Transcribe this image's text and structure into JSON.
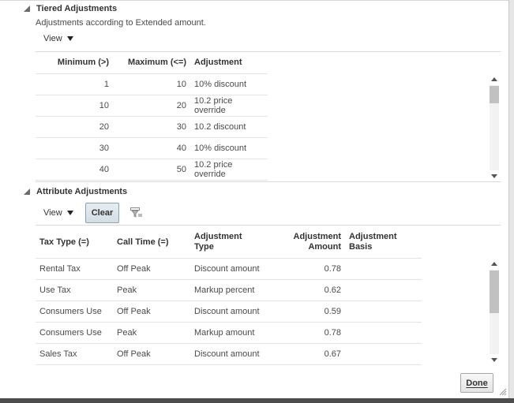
{
  "tiered": {
    "title": "Tiered Adjustments",
    "description": "Adjustments according to Extended amount.",
    "view_label": "View",
    "columns": [
      "Minimum (>)",
      "Maximum (<=)",
      "Adjustment"
    ],
    "rows": [
      [
        "1",
        "10",
        "10% discount"
      ],
      [
        "10",
        "20",
        "10.2 price override"
      ],
      [
        "20",
        "30",
        "10.2 discount"
      ],
      [
        "30",
        "40",
        "10% discount"
      ],
      [
        "40",
        "50",
        "10.2 price override"
      ]
    ]
  },
  "attribute": {
    "title": "Attribute Adjustments",
    "view_label": "View",
    "clear_label": "Clear",
    "columns": {
      "tax_type": "Tax Type (=)",
      "call_time": "Call Time (=)",
      "adj_type_1": "Adjustment",
      "adj_type_2": "Type",
      "adj_amount_1": "Adjustment",
      "adj_amount_2": "Amount",
      "adj_basis_1": "Adjustment",
      "adj_basis_2": "Basis"
    },
    "rows": [
      [
        "Rental Tax",
        "Off Peak",
        "Discount amount",
        "0.78",
        ""
      ],
      [
        "Use Tax",
        "Peak",
        "Markup percent",
        "0.62",
        ""
      ],
      [
        "Consumers Use",
        "Off Peak",
        "Discount amount",
        "0.59",
        ""
      ],
      [
        "Consumers Use",
        "Peak",
        "Markup amount",
        "0.78",
        ""
      ],
      [
        "Sales Tax",
        "Off Peak",
        "Discount amount",
        "0.67",
        ""
      ]
    ]
  },
  "footer": {
    "done_label": "Done"
  },
  "colors": {
    "frame": "#4d4d4d",
    "button_border": "#a7a7a7",
    "scroll_thumb": "#c1c1c1"
  },
  "icons": {
    "section_toggle": "triangle-expanded-icon",
    "view_caret": "caret-down-icon",
    "filter": "query-by-example-icon",
    "resize": "resize-grip-icon"
  }
}
